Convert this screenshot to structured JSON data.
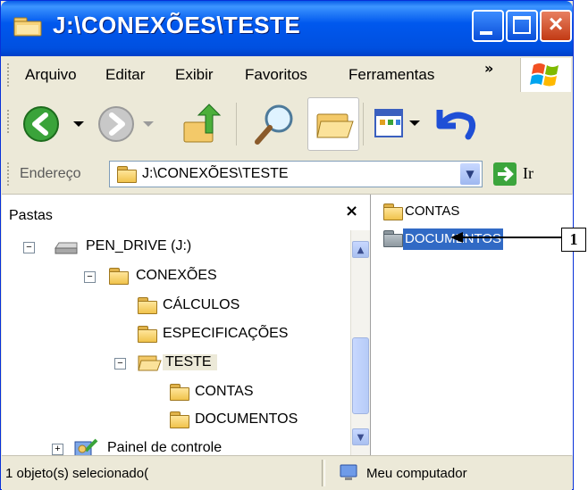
{
  "window": {
    "title": "J:\\CONEXÕES\\TESTE"
  },
  "menu": [
    "Arquivo",
    "Editar",
    "Exibir",
    "Favoritos",
    "Ferramentas"
  ],
  "menu_overflow": "»",
  "address": {
    "label": "Endereço",
    "value": "J:\\CONEXÕES\\TESTE",
    "go_label": "Ir"
  },
  "folders_pane": {
    "title": "Pastas",
    "close": "×",
    "items": [
      {
        "label": "PEN_DRIVE (J:)",
        "expander": "−",
        "icon": "drive-icon"
      },
      {
        "label": "CONEXÕES",
        "expander": "−",
        "icon": "folder-icon"
      },
      {
        "label": "CÁLCULOS",
        "expander": "",
        "icon": "folder-icon"
      },
      {
        "label": "ESPECIFICAÇÕES",
        "expander": "",
        "icon": "folder-icon"
      },
      {
        "label": "TESTE",
        "expander": "−",
        "icon": "folder-open-icon"
      },
      {
        "label": "CONTAS",
        "expander": "",
        "icon": "folder-icon"
      },
      {
        "label": "DOCUMENTOS",
        "expander": "",
        "icon": "folder-icon"
      },
      {
        "label": "Painel de controle",
        "expander": "+",
        "icon": "control-panel-icon"
      }
    ]
  },
  "files": [
    {
      "label": "CONTAS",
      "selected": false
    },
    {
      "label": "DOCUMENTOS",
      "selected": true
    }
  ],
  "status": {
    "left": "1 objeto(s) selecionado(",
    "right": "Meu computador"
  },
  "callout": {
    "label": "1"
  }
}
